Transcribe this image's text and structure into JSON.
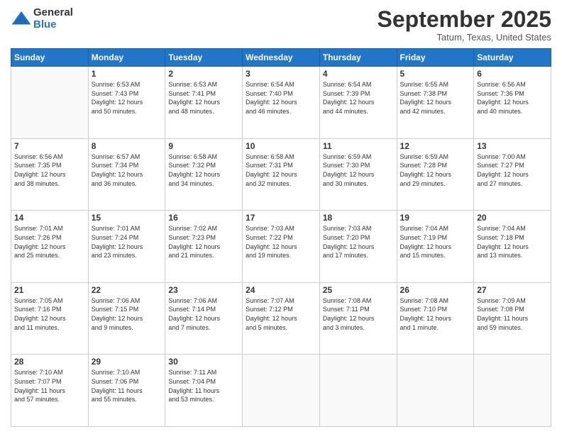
{
  "logo": {
    "general": "General",
    "blue": "Blue"
  },
  "header": {
    "month": "September 2025",
    "location": "Tatum, Texas, United States"
  },
  "weekdays": [
    "Sunday",
    "Monday",
    "Tuesday",
    "Wednesday",
    "Thursday",
    "Friday",
    "Saturday"
  ],
  "weeks": [
    [
      {
        "day": "",
        "info": ""
      },
      {
        "day": "1",
        "info": "Sunrise: 6:53 AM\nSunset: 7:43 PM\nDaylight: 12 hours\nand 50 minutes."
      },
      {
        "day": "2",
        "info": "Sunrise: 6:53 AM\nSunset: 7:41 PM\nDaylight: 12 hours\nand 48 minutes."
      },
      {
        "day": "3",
        "info": "Sunrise: 6:54 AM\nSunset: 7:40 PM\nDaylight: 12 hours\nand 46 minutes."
      },
      {
        "day": "4",
        "info": "Sunrise: 6:54 AM\nSunset: 7:39 PM\nDaylight: 12 hours\nand 44 minutes."
      },
      {
        "day": "5",
        "info": "Sunrise: 6:55 AM\nSunset: 7:38 PM\nDaylight: 12 hours\nand 42 minutes."
      },
      {
        "day": "6",
        "info": "Sunrise: 6:56 AM\nSunset: 7:36 PM\nDaylight: 12 hours\nand 40 minutes."
      }
    ],
    [
      {
        "day": "7",
        "info": "Sunrise: 6:56 AM\nSunset: 7:35 PM\nDaylight: 12 hours\nand 38 minutes."
      },
      {
        "day": "8",
        "info": "Sunrise: 6:57 AM\nSunset: 7:34 PM\nDaylight: 12 hours\nand 36 minutes."
      },
      {
        "day": "9",
        "info": "Sunrise: 6:58 AM\nSunset: 7:32 PM\nDaylight: 12 hours\nand 34 minutes."
      },
      {
        "day": "10",
        "info": "Sunrise: 6:58 AM\nSunset: 7:31 PM\nDaylight: 12 hours\nand 32 minutes."
      },
      {
        "day": "11",
        "info": "Sunrise: 6:59 AM\nSunset: 7:30 PM\nDaylight: 12 hours\nand 30 minutes."
      },
      {
        "day": "12",
        "info": "Sunrise: 6:59 AM\nSunset: 7:28 PM\nDaylight: 12 hours\nand 29 minutes."
      },
      {
        "day": "13",
        "info": "Sunrise: 7:00 AM\nSunset: 7:27 PM\nDaylight: 12 hours\nand 27 minutes."
      }
    ],
    [
      {
        "day": "14",
        "info": "Sunrise: 7:01 AM\nSunset: 7:26 PM\nDaylight: 12 hours\nand 25 minutes."
      },
      {
        "day": "15",
        "info": "Sunrise: 7:01 AM\nSunset: 7:24 PM\nDaylight: 12 hours\nand 23 minutes."
      },
      {
        "day": "16",
        "info": "Sunrise: 7:02 AM\nSunset: 7:23 PM\nDaylight: 12 hours\nand 21 minutes."
      },
      {
        "day": "17",
        "info": "Sunrise: 7:03 AM\nSunset: 7:22 PM\nDaylight: 12 hours\nand 19 minutes."
      },
      {
        "day": "18",
        "info": "Sunrise: 7:03 AM\nSunset: 7:20 PM\nDaylight: 12 hours\nand 17 minutes."
      },
      {
        "day": "19",
        "info": "Sunrise: 7:04 AM\nSunset: 7:19 PM\nDaylight: 12 hours\nand 15 minutes."
      },
      {
        "day": "20",
        "info": "Sunrise: 7:04 AM\nSunset: 7:18 PM\nDaylight: 12 hours\nand 13 minutes."
      }
    ],
    [
      {
        "day": "21",
        "info": "Sunrise: 7:05 AM\nSunset: 7:16 PM\nDaylight: 12 hours\nand 11 minutes."
      },
      {
        "day": "22",
        "info": "Sunrise: 7:06 AM\nSunset: 7:15 PM\nDaylight: 12 hours\nand 9 minutes."
      },
      {
        "day": "23",
        "info": "Sunrise: 7:06 AM\nSunset: 7:14 PM\nDaylight: 12 hours\nand 7 minutes."
      },
      {
        "day": "24",
        "info": "Sunrise: 7:07 AM\nSunset: 7:12 PM\nDaylight: 12 hours\nand 5 minutes."
      },
      {
        "day": "25",
        "info": "Sunrise: 7:08 AM\nSunset: 7:11 PM\nDaylight: 12 hours\nand 3 minutes."
      },
      {
        "day": "26",
        "info": "Sunrise: 7:08 AM\nSunset: 7:10 PM\nDaylight: 12 hours\nand 1 minute."
      },
      {
        "day": "27",
        "info": "Sunrise: 7:09 AM\nSunset: 7:08 PM\nDaylight: 11 hours\nand 59 minutes."
      }
    ],
    [
      {
        "day": "28",
        "info": "Sunrise: 7:10 AM\nSunset: 7:07 PM\nDaylight: 11 hours\nand 57 minutes."
      },
      {
        "day": "29",
        "info": "Sunrise: 7:10 AM\nSunset: 7:06 PM\nDaylight: 11 hours\nand 55 minutes."
      },
      {
        "day": "30",
        "info": "Sunrise: 7:11 AM\nSunset: 7:04 PM\nDaylight: 11 hours\nand 53 minutes."
      },
      {
        "day": "",
        "info": ""
      },
      {
        "day": "",
        "info": ""
      },
      {
        "day": "",
        "info": ""
      },
      {
        "day": "",
        "info": ""
      }
    ]
  ]
}
